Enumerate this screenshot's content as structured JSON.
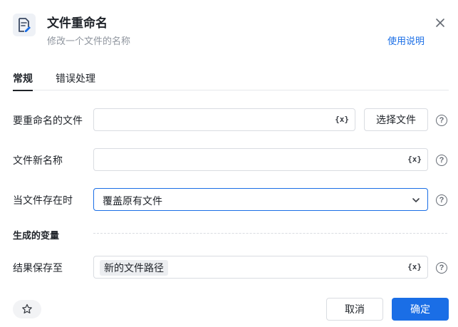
{
  "header": {
    "title": "文件重命名",
    "subtitle": "修改一个文件的名称",
    "help_link": "使用说明",
    "icon": "file-edit-icon"
  },
  "tabs": [
    {
      "label": "常规",
      "active": true
    },
    {
      "label": "错误处理",
      "active": false
    }
  ],
  "form": {
    "file_to_rename": {
      "label": "要重命名的文件",
      "value": "",
      "choose_button": "选择文件"
    },
    "new_name": {
      "label": "文件新名称",
      "value": ""
    },
    "when_exists": {
      "label": "当文件存在时",
      "selected": "覆盖原有文件"
    },
    "variables_section": "生成的变量",
    "save_result": {
      "label": "结果保存至",
      "variable": "新的文件路径"
    },
    "variable_icon_text": "{x}",
    "help_mark": "?"
  },
  "footer": {
    "cancel": "取消",
    "ok": "确定"
  },
  "colors": {
    "accent": "#1a6ee6",
    "border": "#d9dce1",
    "muted_text": "#8f959e"
  }
}
